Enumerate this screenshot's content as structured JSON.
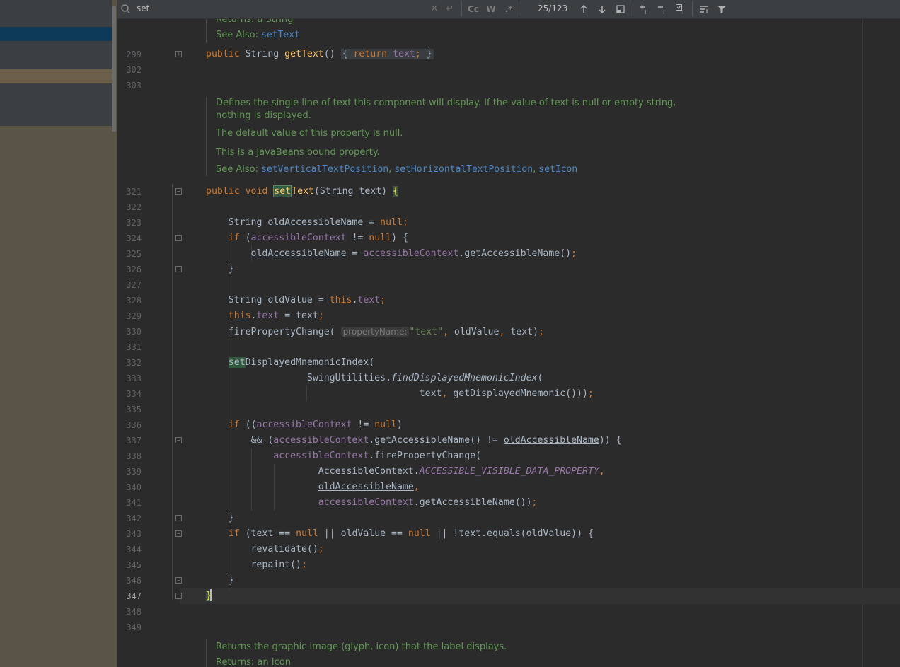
{
  "search": {
    "query": "set",
    "match_counter": "25/123"
  },
  "icons": {
    "search": "search-icon",
    "clear": "close-icon",
    "newline": "newline-icon",
    "match_case": "Cc",
    "words": "W",
    "regex": ".*",
    "prev": "arrow-up-icon",
    "next": "arrow-down-icon",
    "select_all": "select-all-icon",
    "add_selection": "add-occurrence-icon",
    "remove_selection": "remove-occurrence-icon",
    "select_all_occurrences": "select-all-occurrences-icon",
    "multiline": "multiline-icon",
    "filter": "filter-icon"
  },
  "gutter": [
    "299",
    "302",
    "303",
    "321",
    "322",
    "323",
    "324",
    "325",
    "326",
    "327",
    "328",
    "329",
    "330",
    "331",
    "332",
    "333",
    "334",
    "335",
    "336",
    "337",
    "338",
    "339",
    "340",
    "341",
    "342",
    "343",
    "344",
    "345",
    "346",
    "347",
    "348",
    "349"
  ],
  "doc_top": {
    "returns": "Returns:  a String",
    "see_also_label": "See Also: ",
    "see_also": "setText"
  },
  "doc_mid": {
    "p1": "Defines the single line of text this component will display. If the value of text is null or empty string,",
    "p1b": "nothing is displayed.",
    "p2": "The default value of this property is null.",
    "p3": "This is a JavaBeans bound property.",
    "see_also_label": "See Also: ",
    "link1": "setVerticalTextPosition",
    "link2": "setHorizontalTextPosition",
    "link3": "setIcon"
  },
  "doc_bottom": {
    "p1": "Returns the graphic image (glyph, icon) that the label displays.",
    "returns": "Returns:  an Icon"
  },
  "hint": {
    "property_name": "propertyName:"
  }
}
